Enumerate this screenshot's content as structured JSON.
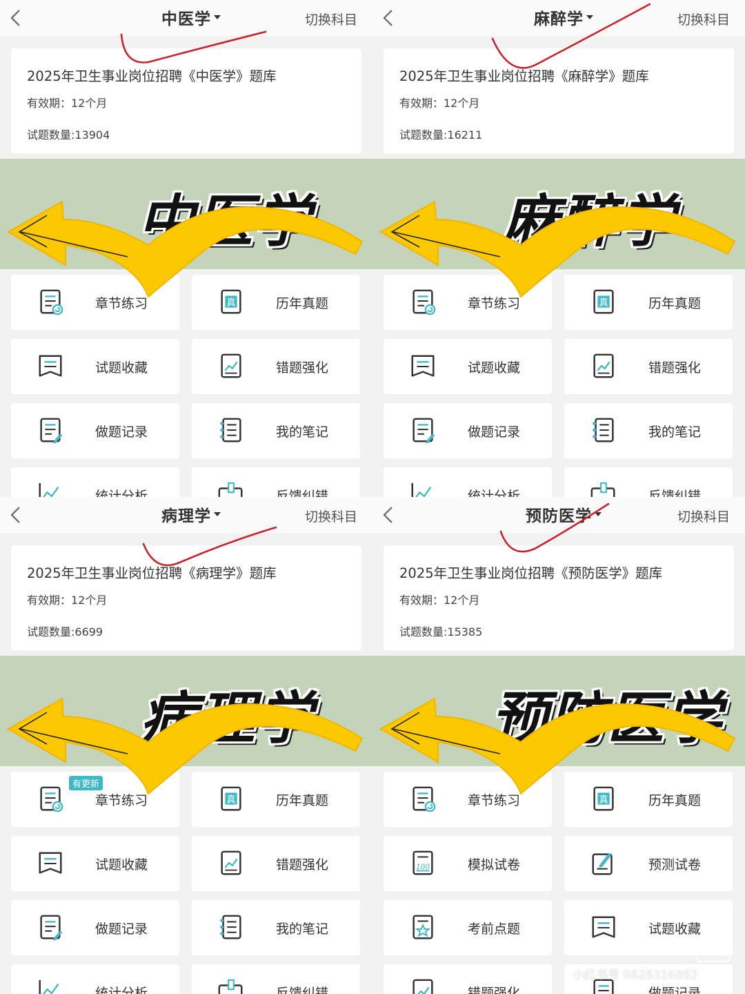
{
  "colors": {
    "banner": "#c3d4b8",
    "arrow_yellow": "#fcc800",
    "teal": "#3db8c5",
    "red_mark": "#c8232c"
  },
  "panels": [
    {
      "subject": "中医学",
      "switch_label": "切换科目",
      "bank_title": "2025年卫生事业岗位招聘《中医学》题库",
      "validity": "有效期：12个月",
      "count": "试题数量:13904",
      "banner_text": "中医学",
      "tiles": [
        {
          "label": "章节练习",
          "icon": "chapter-practice-icon"
        },
        {
          "label": "历年真题",
          "icon": "past-exam-icon"
        },
        {
          "label": "试题收藏",
          "icon": "bookmark-icon"
        },
        {
          "label": "错题强化",
          "icon": "mistake-chart-icon"
        },
        {
          "label": "做题记录",
          "icon": "record-icon"
        },
        {
          "label": "我的笔记",
          "icon": "notebook-icon"
        },
        {
          "label": "统计分析",
          "icon": "stats-icon"
        },
        {
          "label": "反馈纠错",
          "icon": "feedback-icon"
        }
      ]
    },
    {
      "subject": "麻醉学",
      "switch_label": "切换科目",
      "bank_title": "2025年卫生事业岗位招聘《麻醉学》题库",
      "validity": "有效期：12个月",
      "count": "试题数量:16211",
      "banner_text": "麻醉学",
      "tiles": [
        {
          "label": "章节练习",
          "icon": "chapter-practice-icon"
        },
        {
          "label": "历年真题",
          "icon": "past-exam-icon"
        },
        {
          "label": "试题收藏",
          "icon": "bookmark-icon"
        },
        {
          "label": "错题强化",
          "icon": "mistake-chart-icon"
        },
        {
          "label": "做题记录",
          "icon": "record-icon"
        },
        {
          "label": "我的笔记",
          "icon": "notebook-icon"
        },
        {
          "label": "统计分析",
          "icon": "stats-icon"
        },
        {
          "label": "反馈纠错",
          "icon": "feedback-icon"
        }
      ]
    },
    {
      "subject": "病理学",
      "switch_label": "切换科目",
      "bank_title": "2025年卫生事业岗位招聘《病理学》题库",
      "validity": "有效期：12个月",
      "count": "试题数量:6699",
      "banner_text": "病理学",
      "badge": "有更新",
      "tiles": [
        {
          "label": "章节练习",
          "icon": "chapter-practice-icon"
        },
        {
          "label": "历年真题",
          "icon": "past-exam-icon"
        },
        {
          "label": "试题收藏",
          "icon": "bookmark-icon"
        },
        {
          "label": "错题强化",
          "icon": "mistake-chart-icon"
        },
        {
          "label": "做题记录",
          "icon": "record-icon"
        },
        {
          "label": "我的笔记",
          "icon": "notebook-icon"
        },
        {
          "label": "统计分析",
          "icon": "stats-icon"
        },
        {
          "label": "反馈纠错",
          "icon": "feedback-icon"
        }
      ]
    },
    {
      "subject": "预防医学",
      "switch_label": "切换科目",
      "bank_title": "2025年卫生事业岗位招聘《预防医学》题库",
      "validity": "有效期：12个月",
      "count": "试题数量:15385",
      "banner_text": "预防医学",
      "tiles": [
        {
          "label": "章节练习",
          "icon": "chapter-practice-icon"
        },
        {
          "label": "历年真题",
          "icon": "past-exam-icon"
        },
        {
          "label": "模拟试卷",
          "icon": "mock-exam-icon"
        },
        {
          "label": "预测试卷",
          "icon": "forecast-exam-icon"
        },
        {
          "label": "考前点题",
          "icon": "star-tips-icon"
        },
        {
          "label": "试题收藏",
          "icon": "bookmark-icon"
        },
        {
          "label": "错题强化",
          "icon": "mistake-chart-icon"
        },
        {
          "label": "做题记录",
          "icon": "record-icon"
        }
      ]
    }
  ],
  "watermark": "小红书号 9626316882",
  "watermark_logo": "小红书"
}
